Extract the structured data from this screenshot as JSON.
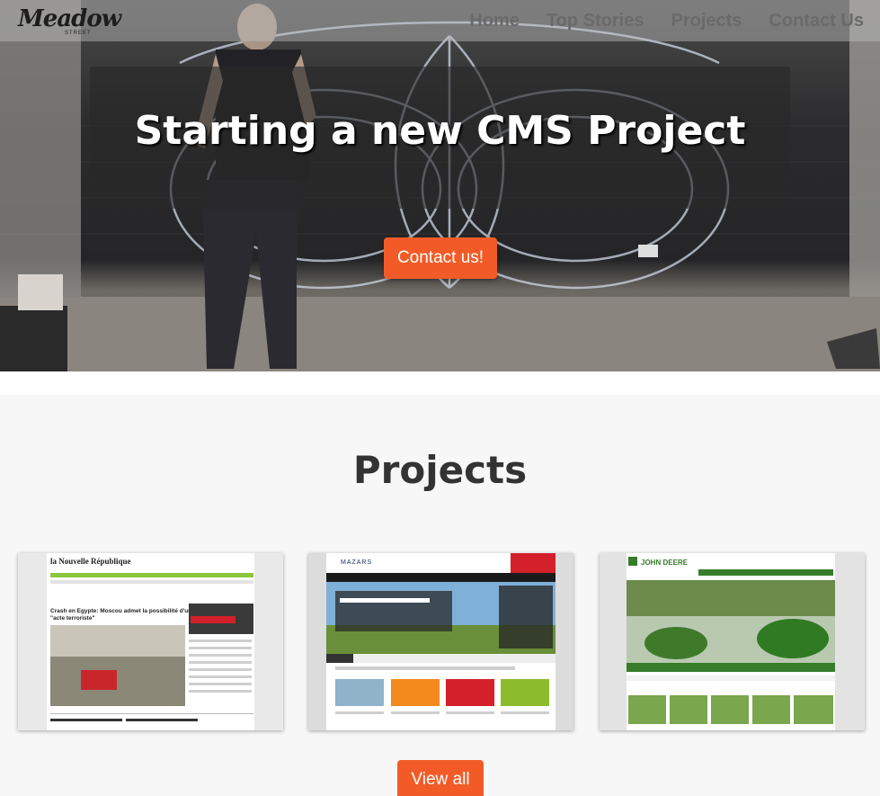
{
  "brand": {
    "logo_text": "Meadow",
    "logo_sub": "STREET"
  },
  "nav": {
    "items": [
      "Home",
      "Top Stories",
      "Projects",
      "Contact Us"
    ]
  },
  "hero": {
    "headline": "Starting a new CMS Project",
    "cta_label": "Contact us!"
  },
  "projects": {
    "title": "Projects",
    "view_all_label": "View all",
    "cards": [
      {
        "name": "la Nouvelle République",
        "headline": "Crash en Egypte: Moscou admet la possibilité d'un \"acte terroriste\"",
        "accent": "#8cc63f"
      },
      {
        "name": "MAZARS",
        "headline": "MAZARS SOUTIENT LA COP 21",
        "accent": "#d4202a"
      },
      {
        "name": "JOHN DEERE",
        "headline": "DEERE",
        "accent": "#367c2b"
      }
    ]
  },
  "colors": {
    "accent": "#f25b27",
    "nav_text": "#6a6a6a",
    "title_text": "#333333"
  }
}
